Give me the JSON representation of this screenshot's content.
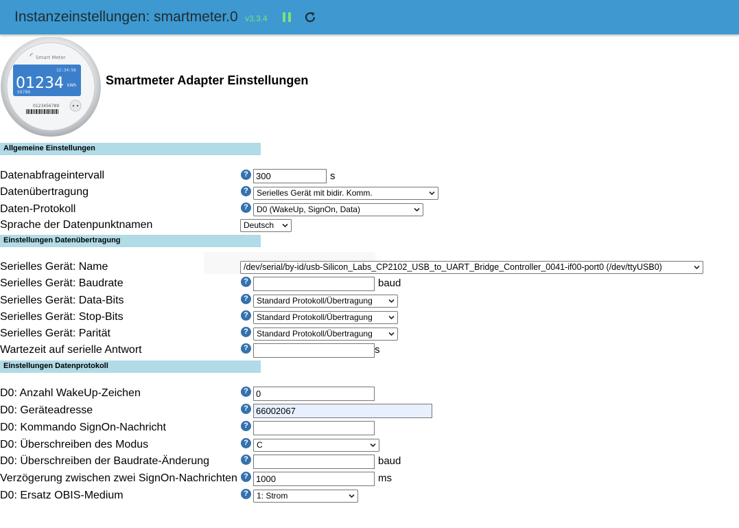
{
  "header": {
    "title": "Instanzeinstellungen: smartmeter.0",
    "version": "v3.3.4"
  },
  "logo": {
    "brand": "Smart Meter",
    "time": "12:34:56",
    "reading": "01234",
    "unit": "kWh",
    "small_number": "56789",
    "serial": "0123456789"
  },
  "page_heading": "Smartmeter Adapter Einstellungen",
  "sections": {
    "general": "Allgemeine Einstellungen",
    "transfer": "Einstellungen Datenübertragung",
    "protocol": "Einstellungen Datenprotokoll"
  },
  "general": {
    "interval_label": "Datenabfrageintervall",
    "interval_value": "300",
    "interval_unit": "s",
    "transfer_label": "Datenübertragung",
    "transfer_value": "Serielles Gerät mit bidir. Komm.",
    "protocol_label": "Daten-Protokoll",
    "protocol_value": "D0 (WakeUp, SignOn, Data)",
    "language_label": "Sprache der Datenpunktnamen",
    "language_value": "Deutsch"
  },
  "serial": {
    "name_label": "Serielles Gerät: Name",
    "name_value": "/dev/serial/by-id/usb-Silicon_Labs_CP2102_USB_to_UART_Bridge_Controller_0041-if00-port0 (/dev/ttyUSB0)",
    "baud_label": "Serielles Gerät: Baudrate",
    "baud_value": "",
    "baud_unit": "baud",
    "databits_label": "Serielles Gerät: Data-Bits",
    "databits_value": "Standard Protokoll/Übertragung",
    "stopbits_label": "Serielles Gerät: Stop-Bits",
    "stopbits_value": "Standard Protokoll/Übertragung",
    "parity_label": "Serielles Gerät: Parität",
    "parity_value": "Standard Protokoll/Übertragung",
    "wait_label": "Wartezeit auf serielle Antwort",
    "wait_value": "",
    "wait_unit": "s"
  },
  "protocol": {
    "wakeup_label": "D0: Anzahl WakeUp-Zeichen",
    "wakeup_value": "0",
    "address_label": "D0: Geräteadresse",
    "address_value": "66002067",
    "signon_label": "D0: Kommando SignOn-Nachricht",
    "signon_value": "",
    "mode_label": "D0: Überschreiben des Modus",
    "mode_value": "C",
    "baudchange_label": "D0: Überschreiben der Baudrate-Änderung",
    "baudchange_value": "",
    "baudchange_unit": "baud",
    "delay_label": "Verzögerung zwischen zwei SignOn-Nachrichten",
    "delay_value": "1000",
    "delay_unit": "ms",
    "obis_label": "D0: Ersatz OBIS-Medium",
    "obis_value": "1: Strom"
  },
  "help_glyph": "?",
  "colors": {
    "header_bg": "#3d99d0",
    "version_green": "#7fe07a",
    "section_bg": "#b0dbe7",
    "help_blue": "#3471ad"
  },
  "icons": {
    "pause": "pause-icon",
    "reload": "reload-icon",
    "help": "help-icon",
    "chevron": "chevron-down-icon"
  }
}
